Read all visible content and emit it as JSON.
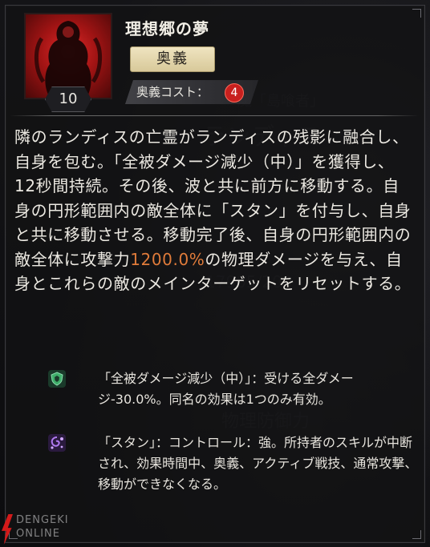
{
  "skill": {
    "name": "理想郷の夢",
    "level": "10",
    "tag": "奥義",
    "cost_label": "奥義コスト：",
    "cost_value": "4",
    "icon": "red-silhouette-skill-icon"
  },
  "description": {
    "part1": "隣のランディスの亡霊がランディスの残影に融合し、自身を包む。「全被ダメージ減少（中）」を獲得し、12秒間持続。その後、波と共に前方に移動する。自身の円形範囲内の敵全体に「スタン」を付与し、自身と共に移動させる。移動完了後、自身の円形範囲内の敵全体に攻撃力",
    "highlight": "1200.0%",
    "part2": "の物理ダメージを与え、自身とこれらの敵のメインターゲットをリセットする。"
  },
  "effects": [
    {
      "icon": "green-shield-icon",
      "text": "「全被ダメージ減少（中）」：受ける全ダメージ-30.0%。同名の効果は1つのみ有効。"
    },
    {
      "icon": "purple-stun-swirl-icon",
      "text": "「スタン」：コントロール：強。所持者のスキルが中断され、効果時間中、奥義、アクティブ戦技、通常攻撃、移動ができなくなる。"
    }
  ],
  "watermark": {
    "line1": "DENGEKI",
    "line2": "ONLINE"
  },
  "colors": {
    "highlight": "#e07b3a",
    "cost_badge": "#c8201e",
    "tag_bg": "#e6d9ae"
  }
}
